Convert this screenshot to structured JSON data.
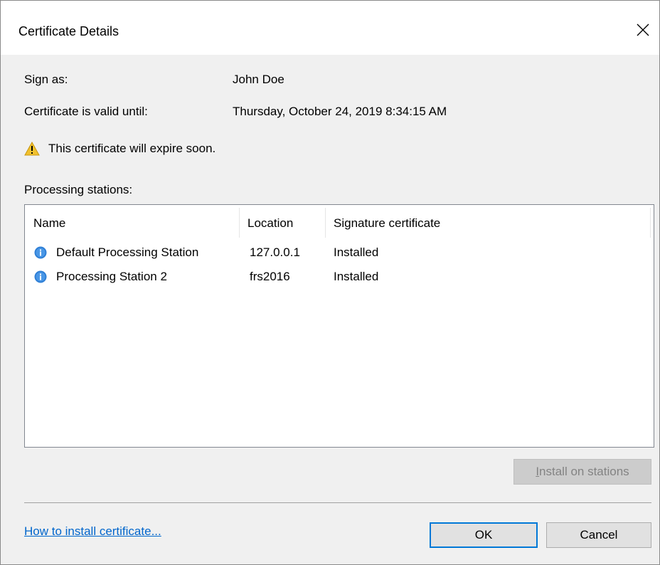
{
  "window": {
    "title": "Certificate Details"
  },
  "fields": {
    "sign_as_label": "Sign as:",
    "sign_as_value": "John Doe",
    "valid_until_label": "Certificate is valid until:",
    "valid_until_value": "Thursday, October 24, 2019 8:34:15 AM"
  },
  "warning": {
    "icon": "warning-icon",
    "text": "This certificate will expire soon."
  },
  "stations": {
    "label": "Processing stations:",
    "columns": [
      "Name",
      "Location",
      "Signature certificate"
    ],
    "rows": [
      {
        "icon": "info-icon",
        "name": "Default Processing Station",
        "location": "127.0.0.1",
        "certificate": "Installed"
      },
      {
        "icon": "info-icon",
        "name": "Processing Station 2",
        "location": "frs2016",
        "certificate": "Installed"
      }
    ]
  },
  "buttons": {
    "install_prefix": "I",
    "install_rest": "nstall on stations",
    "ok": "OK",
    "cancel": "Cancel"
  },
  "help_link": "How to install certificate...",
  "colors": {
    "accent": "#0078d7",
    "link": "#0066cc",
    "warning": "#f2c12e",
    "info": "#2f7fd6"
  }
}
